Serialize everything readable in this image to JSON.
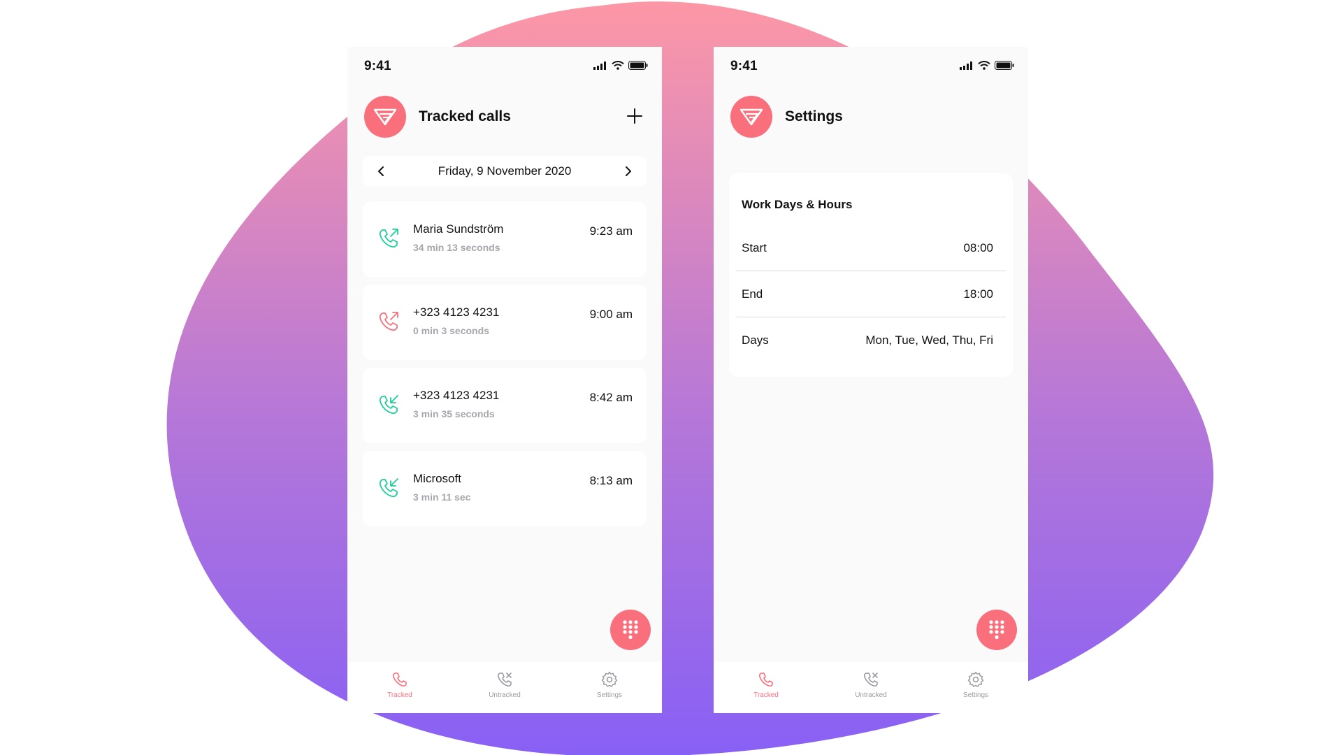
{
  "colors": {
    "accent": "#f9707c",
    "incoming_green": "#1fcf9a",
    "background_gradient_top": "#fd97a6",
    "background_gradient_bottom": "#8860f5"
  },
  "left_screen": {
    "status": {
      "time": "9:41"
    },
    "header": {
      "title": "Tracked calls",
      "logo_icon": "app-logo-icon",
      "add_icon": "plus-icon"
    },
    "date_nav": {
      "date": "Friday, 9 November 2020",
      "prev_icon": "chevron-left-icon",
      "next_icon": "chevron-right-icon"
    },
    "calls": [
      {
        "name": "Maria Sundström",
        "duration": "34 min 13 seconds",
        "time": "9:23 am",
        "direction": "outgoing",
        "icon_color": "#1fcf9a"
      },
      {
        "name": "+323 4123 4231",
        "duration": "0 min 3 seconds",
        "time": "9:00 am",
        "direction": "outgoing",
        "icon_color": "#f9707c"
      },
      {
        "name": "+323 4123 4231",
        "duration": "3 min 35 seconds",
        "time": "8:42 am",
        "direction": "incoming",
        "icon_color": "#1fcf9a"
      },
      {
        "name": "Microsoft",
        "duration": "3 min 11 sec",
        "time": "8:13 am",
        "direction": "incoming",
        "icon_color": "#1fcf9a"
      }
    ],
    "fab_icon": "dialpad-icon",
    "tabs": [
      {
        "label": "Tracked",
        "icon": "phone-icon",
        "active": true
      },
      {
        "label": "Untracked",
        "icon": "phone-missed-icon",
        "active": false
      },
      {
        "label": "Settings",
        "icon": "gear-icon",
        "active": false
      }
    ]
  },
  "right_screen": {
    "status": {
      "time": "9:41"
    },
    "header": {
      "title": "Settings",
      "logo_icon": "app-logo-icon"
    },
    "work_hours": {
      "title": "Work Days & Hours",
      "rows": [
        {
          "label": "Start",
          "value": "08:00"
        },
        {
          "label": "End",
          "value": "18:00"
        },
        {
          "label": "Days",
          "value": "Mon, Tue, Wed, Thu, Fri"
        }
      ]
    },
    "fab_icon": "dialpad-icon",
    "tabs": [
      {
        "label": "Tracked",
        "icon": "phone-icon",
        "active": true
      },
      {
        "label": "Untracked",
        "icon": "phone-missed-icon",
        "active": false
      },
      {
        "label": "Settings",
        "icon": "gear-icon",
        "active": false
      }
    ]
  }
}
